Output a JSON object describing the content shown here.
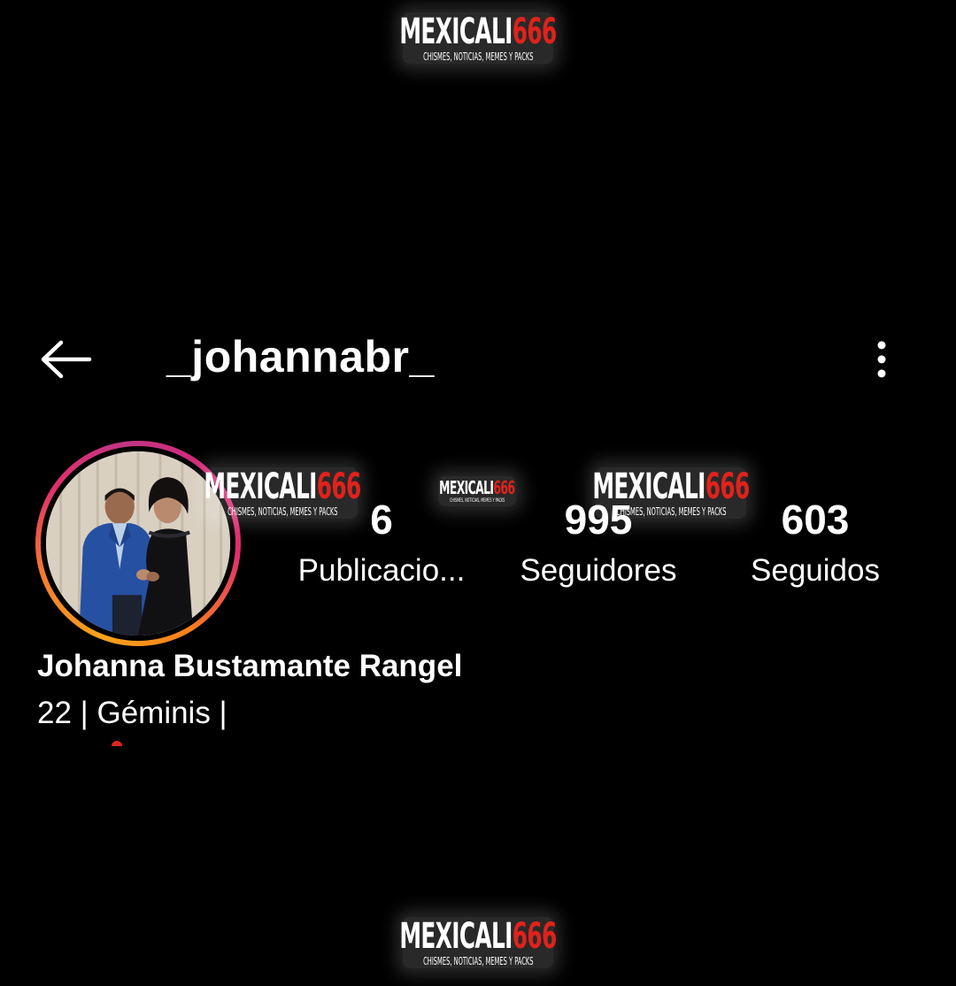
{
  "header": {
    "username": "_johannabr_",
    "back_icon": "arrow-left-icon",
    "menu_icon": "more-vertical-icon"
  },
  "profile": {
    "full_name": "Johanna Bustamante Rangel",
    "bio": "22 | Géminis |",
    "story_ring_colors": [
      "#f9a21b",
      "#e1306c",
      "#c13584"
    ]
  },
  "stats": [
    {
      "count": "6",
      "label": "Publicacio..."
    },
    {
      "count": "995",
      "label": "Seguidores"
    },
    {
      "count": "603",
      "label": "Seguidos"
    }
  ],
  "watermark": {
    "title_main": "MEXICALI",
    "title_number": "666",
    "subtitle": "CHISMES, NOTICIAS, MEMES Y PACKS",
    "accent_color": "#e0221c"
  }
}
